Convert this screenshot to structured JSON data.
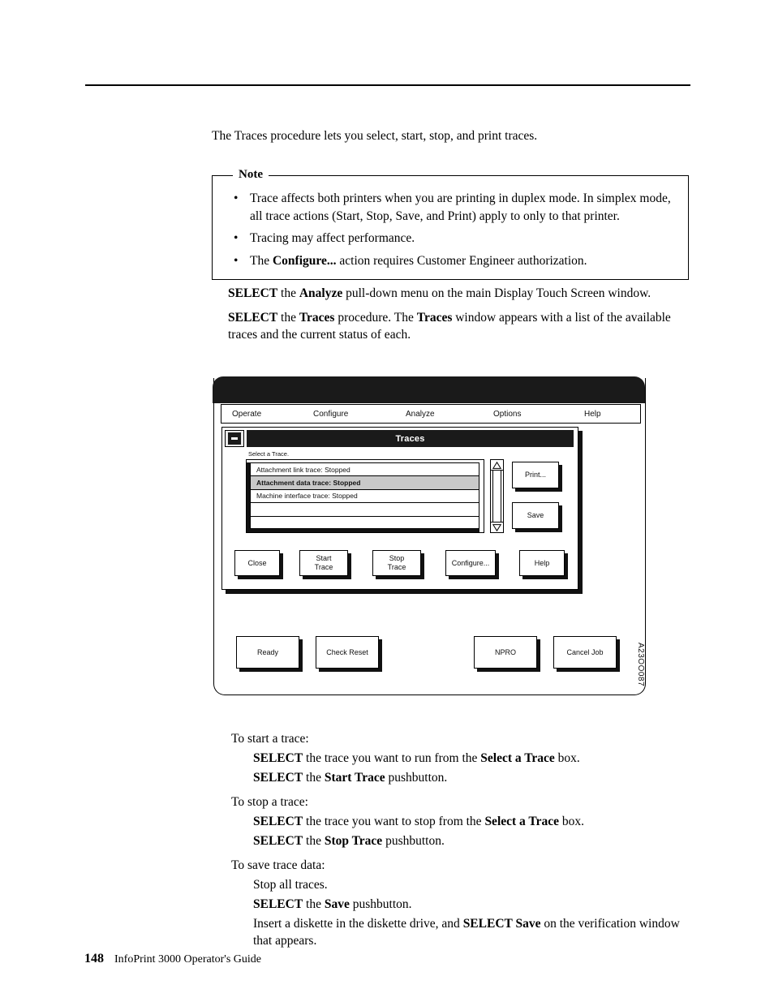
{
  "page": {
    "intro": "The Traces procedure lets you select, start, stop, and print traces.",
    "footer_page_number": "148",
    "footer_title": "InfoPrint 3000 Operator's Guide"
  },
  "note": {
    "legend": "Note",
    "items": [
      {
        "pre": "Trace affects both printers when you are printing in duplex mode. In simplex mode, all trace actions (Start, Stop, Save, and Print) apply to only to that printer.",
        "bold": "",
        "post": ""
      },
      {
        "pre": "Tracing may affect performance.",
        "bold": "",
        "post": ""
      },
      {
        "pre": "The ",
        "bold": "Configure...",
        "post": " action requires Customer Engineer authorization."
      }
    ],
    "bullet_glyph": "•"
  },
  "steps": [
    {
      "b1": "SELECT",
      "t1": " the ",
      "b2": "Analyze",
      "t2": " pull-down menu on the main Display Touch Screen window."
    },
    {
      "b1": "SELECT",
      "t1": " the ",
      "b2": "Traces",
      "t2": " procedure. The ",
      "b3": "Traces",
      "t3": " window appears with a list of the available traces and the current status of each."
    }
  ],
  "figure": {
    "id_label": "A23OO087",
    "menubar": [
      {
        "label": "Operate"
      },
      {
        "label": "Configure"
      },
      {
        "label": "Analyze"
      },
      {
        "label": "Options"
      },
      {
        "label": "Help"
      }
    ],
    "dialog": {
      "title": "Traces",
      "minimize_icon": "minimize-icon",
      "list_label": "Select a Trace.",
      "traces": [
        {
          "label": "Attachment link trace: Stopped",
          "selected": false
        },
        {
          "label": "Attachment data trace: Stopped",
          "selected": true
        },
        {
          "label": "Machine interface trace: Stopped",
          "selected": false
        },
        {
          "label": "",
          "selected": false
        },
        {
          "label": "",
          "selected": false
        }
      ],
      "side_buttons": [
        {
          "label": "Print..."
        },
        {
          "label": "Save"
        }
      ],
      "action_buttons": [
        {
          "label": "Close"
        },
        {
          "label": "Start\nTrace"
        },
        {
          "label": "Stop\nTrace"
        },
        {
          "label": "Configure..."
        },
        {
          "label": "Help"
        }
      ],
      "scrollbar": {
        "up_icon": "triangle-up-icon",
        "down_icon": "triangle-down-icon"
      }
    },
    "touchscreen_buttons": [
      {
        "label": "Ready"
      },
      {
        "label": "Check Reset"
      },
      {
        "label": "NPRO"
      },
      {
        "label": "Cancel Job"
      }
    ]
  },
  "procedure": {
    "blocks": [
      {
        "head": "To start a trace:",
        "lines": [
          {
            "b1": "SELECT",
            "t1": " the trace you want to run from the ",
            "b2": "Select a Trace",
            "t2": " box."
          },
          {
            "b1": "SELECT",
            "t1": " the ",
            "b2": "Start Trace",
            "t2": " pushbutton."
          }
        ]
      },
      {
        "head": "To stop a trace:",
        "lines": [
          {
            "b1": "SELECT",
            "t1": " the trace you want to stop from the ",
            "b2": "Select a Trace",
            "t2": " box."
          },
          {
            "b1": "SELECT",
            "t1": " the ",
            "b2": "Stop Trace",
            "t2": " pushbutton."
          }
        ]
      },
      {
        "head": "To save trace data:",
        "lines": [
          {
            "b1": "",
            "t1": "Stop all traces.",
            "b2": "",
            "t2": ""
          },
          {
            "b1": "SELECT",
            "t1": " the ",
            "b2": "Save",
            "t2": " pushbutton."
          },
          {
            "b1": "",
            "t1": "Insert a diskette in the diskette drive, and ",
            "b2": "SELECT Save",
            "t2": " on the verification window that appears."
          }
        ]
      }
    ]
  },
  "colors": {
    "ink": "#000000",
    "paper": "#ffffff",
    "titlebar": "#1a1a1a",
    "selected_row": "#c9c9c9"
  }
}
